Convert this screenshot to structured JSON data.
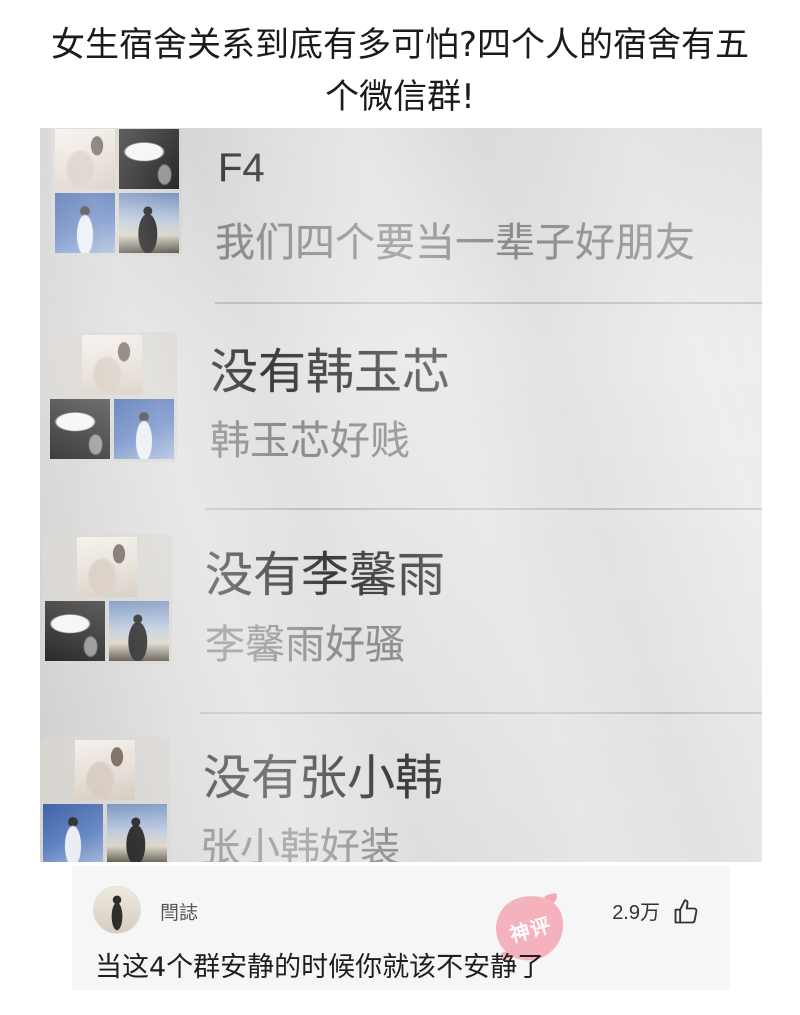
{
  "post": {
    "title": "女生宿舍关系到底有多可怕?四个人的宿舍有五个微信群!"
  },
  "chat_list": {
    "groups": [
      {
        "name": "F4",
        "last_message": "我们四个要当一辈子好朋友"
      },
      {
        "name": "没有韩玉芯",
        "last_message": "韩玉芯好贱"
      },
      {
        "name": "没有李馨雨",
        "last_message": "李馨雨好骚"
      },
      {
        "name": "没有张小韩",
        "last_message": "张小韩好装"
      }
    ]
  },
  "top_comment": {
    "username": "閆誌",
    "likes": "2.9万",
    "text": "当这4个群安静的时候你就该不安静了",
    "badge": "神评"
  },
  "icons": {
    "like": "thumbs-up-icon"
  },
  "colors": {
    "badge": "#f07a8c",
    "card_background": "#f6f6f6",
    "group_name": "#3a3a3a",
    "group_message": "#8a8a8a"
  }
}
